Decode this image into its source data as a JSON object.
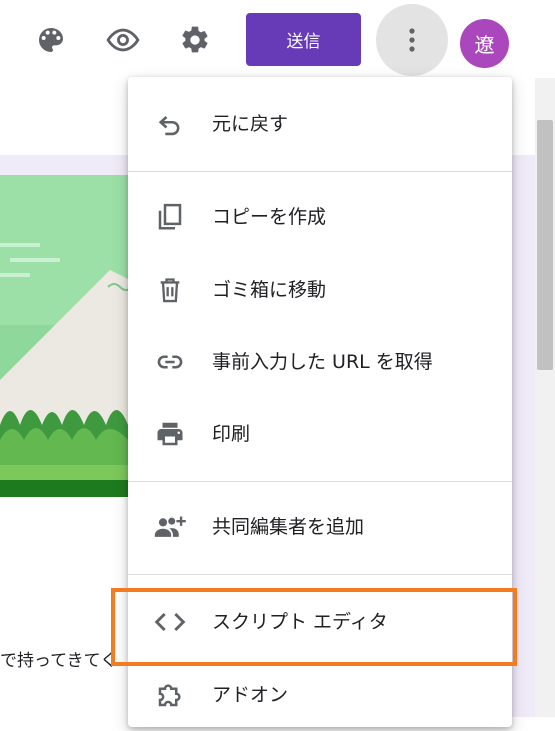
{
  "toolbar": {
    "icons": [
      "palette-icon",
      "eye-icon",
      "gear-icon",
      "more-vert-icon"
    ],
    "send_label": "送信",
    "avatar_initial": "遼"
  },
  "page": {
    "partial_text": "で持ってきてく"
  },
  "menu": {
    "items": [
      {
        "label": "元に戻す",
        "icon": "undo-icon"
      },
      {
        "label": "コピーを作成",
        "icon": "copy-icon"
      },
      {
        "label": "ゴミ箱に移動",
        "icon": "trash-icon"
      },
      {
        "label": "事前入力した URL を取得",
        "icon": "link-icon"
      },
      {
        "label": "印刷",
        "icon": "print-icon"
      },
      {
        "label": "共同編集者を追加",
        "icon": "add-people-icon"
      },
      {
        "label": "スクリプト エディタ",
        "icon": "code-icon"
      },
      {
        "label": "アドオン",
        "icon": "puzzle-icon"
      }
    ]
  },
  "colors": {
    "accent": "#673ab7",
    "avatar": "#ab47bc",
    "highlight": "#f47c20",
    "banner_green": "#7ed08e",
    "banner_dark_green": "#1e7a1e"
  }
}
